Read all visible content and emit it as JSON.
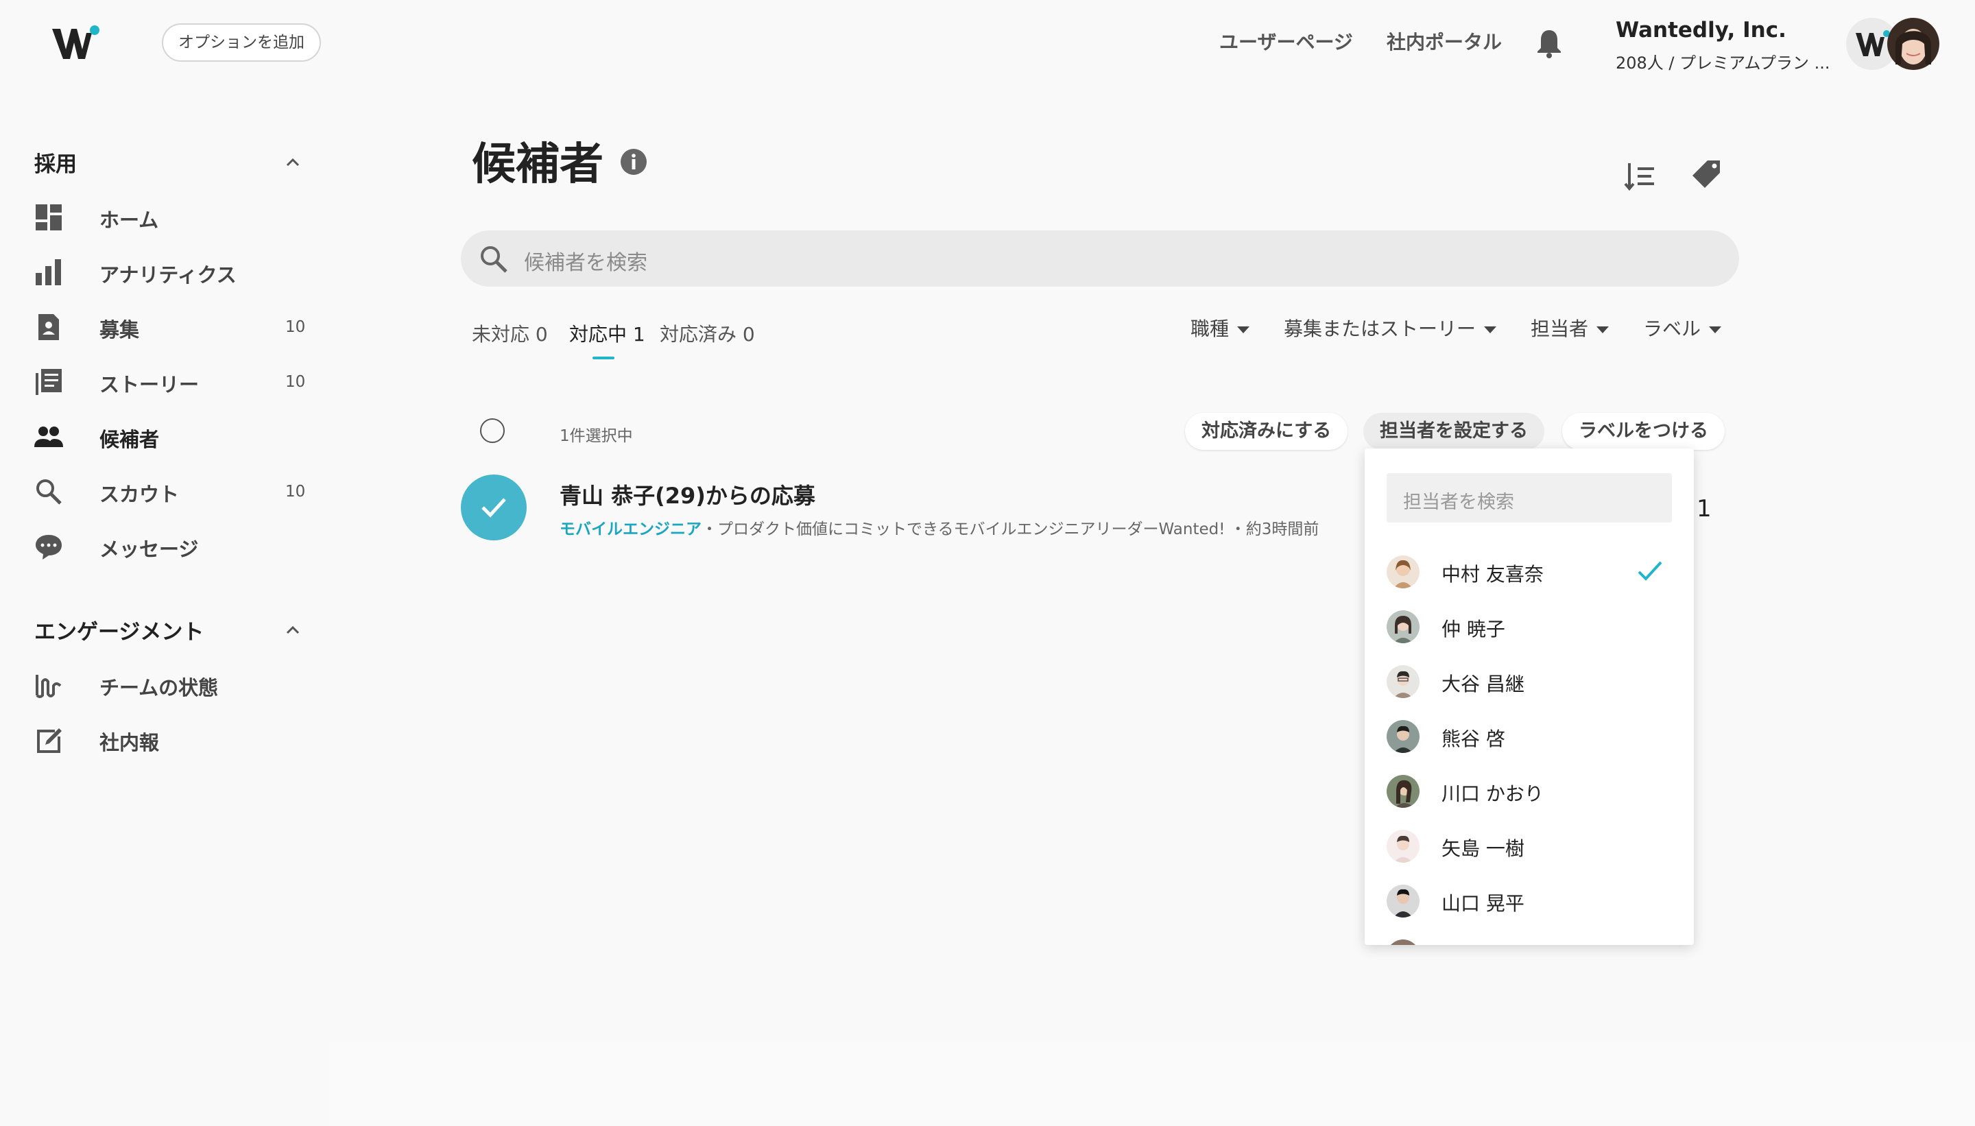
{
  "header": {
    "option_button": "オプションを追加",
    "links": [
      "ユーザーページ",
      "社内ポータル"
    ],
    "company_name": "Wantedly, Inc.",
    "company_sub": "208人 / プレミアムプラン ..."
  },
  "sidebar": {
    "sections": [
      {
        "title": "採用",
        "items": [
          {
            "label": "ホーム",
            "icon": "dashboard-icon",
            "count": ""
          },
          {
            "label": "アナリティクス",
            "icon": "bar-chart-icon",
            "count": ""
          },
          {
            "label": "募集",
            "icon": "job-posting-icon",
            "count": "10"
          },
          {
            "label": "ストーリー",
            "icon": "story-icon",
            "count": "10"
          },
          {
            "label": "候補者",
            "icon": "people-icon",
            "count": ""
          },
          {
            "label": "スカウト",
            "icon": "search-icon",
            "count": "10"
          },
          {
            "label": "メッセージ",
            "icon": "chat-icon",
            "count": ""
          }
        ]
      },
      {
        "title": "エンゲージメント",
        "items": [
          {
            "label": "チームの状態",
            "icon": "team-wave-icon",
            "count": ""
          },
          {
            "label": "社内報",
            "icon": "edit-icon",
            "count": ""
          }
        ]
      }
    ]
  },
  "main": {
    "title": "候補者",
    "search_placeholder": "候補者を検索",
    "tabs": [
      {
        "label": "未対応 0"
      },
      {
        "label": "対応中 1"
      },
      {
        "label": "対応済み 0"
      }
    ],
    "filters": [
      "職種",
      "募集またはストーリー",
      "担当者",
      "ラベル"
    ],
    "selected_count": "1件選択中",
    "actions": [
      "対応済みにする",
      "担当者を設定する",
      "ラベルをつける"
    ],
    "candidate": {
      "name": "青山 恭子(29)からの応募",
      "job": "モバイルエンジニア",
      "meta": "・プロダクト価値にコミットできるモバイルエンジニアリーダーWanted! ・約3時間前",
      "extra": "1"
    }
  },
  "assignee_dropdown": {
    "search_placeholder": "担当者を検索",
    "people": [
      {
        "name": "中村 友喜奈",
        "checked": true,
        "avatar_color": "#c79a72"
      },
      {
        "name": "仲 暁子",
        "checked": false,
        "avatar_color": "#6b7a6e"
      },
      {
        "name": "大谷 昌継",
        "checked": false,
        "avatar_color": "#a08c7e"
      },
      {
        "name": "熊谷 啓",
        "checked": false,
        "avatar_color": "#5f6f68"
      },
      {
        "name": "川口 かおり",
        "checked": false,
        "avatar_color": "#5a5048"
      },
      {
        "name": "矢島 一樹",
        "checked": false,
        "avatar_color": "#e9d6d2"
      },
      {
        "name": "山口 晃平",
        "checked": false,
        "avatar_color": "#2e2e33"
      }
    ],
    "accent_color": "#20b5c8"
  }
}
